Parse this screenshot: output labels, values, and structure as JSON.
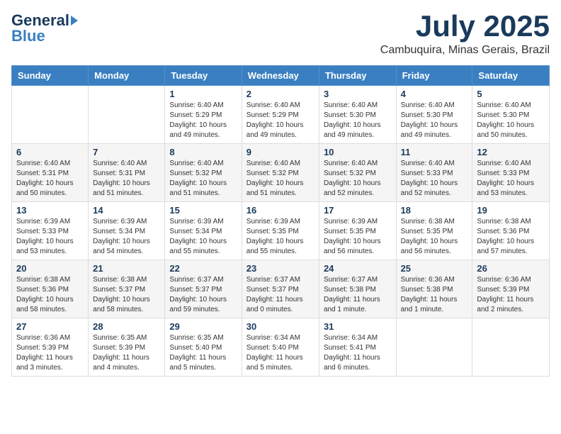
{
  "header": {
    "logo_general": "General",
    "logo_blue": "Blue",
    "month_title": "July 2025",
    "subtitle": "Cambuquira, Minas Gerais, Brazil"
  },
  "weekdays": [
    "Sunday",
    "Monday",
    "Tuesday",
    "Wednesday",
    "Thursday",
    "Friday",
    "Saturday"
  ],
  "weeks": [
    [
      {
        "day": "",
        "info": ""
      },
      {
        "day": "",
        "info": ""
      },
      {
        "day": "1",
        "info": "Sunrise: 6:40 AM\nSunset: 5:29 PM\nDaylight: 10 hours\nand 49 minutes."
      },
      {
        "day": "2",
        "info": "Sunrise: 6:40 AM\nSunset: 5:29 PM\nDaylight: 10 hours\nand 49 minutes."
      },
      {
        "day": "3",
        "info": "Sunrise: 6:40 AM\nSunset: 5:30 PM\nDaylight: 10 hours\nand 49 minutes."
      },
      {
        "day": "4",
        "info": "Sunrise: 6:40 AM\nSunset: 5:30 PM\nDaylight: 10 hours\nand 49 minutes."
      },
      {
        "day": "5",
        "info": "Sunrise: 6:40 AM\nSunset: 5:30 PM\nDaylight: 10 hours\nand 50 minutes."
      }
    ],
    [
      {
        "day": "6",
        "info": "Sunrise: 6:40 AM\nSunset: 5:31 PM\nDaylight: 10 hours\nand 50 minutes."
      },
      {
        "day": "7",
        "info": "Sunrise: 6:40 AM\nSunset: 5:31 PM\nDaylight: 10 hours\nand 51 minutes."
      },
      {
        "day": "8",
        "info": "Sunrise: 6:40 AM\nSunset: 5:32 PM\nDaylight: 10 hours\nand 51 minutes."
      },
      {
        "day": "9",
        "info": "Sunrise: 6:40 AM\nSunset: 5:32 PM\nDaylight: 10 hours\nand 51 minutes."
      },
      {
        "day": "10",
        "info": "Sunrise: 6:40 AM\nSunset: 5:32 PM\nDaylight: 10 hours\nand 52 minutes."
      },
      {
        "day": "11",
        "info": "Sunrise: 6:40 AM\nSunset: 5:33 PM\nDaylight: 10 hours\nand 52 minutes."
      },
      {
        "day": "12",
        "info": "Sunrise: 6:40 AM\nSunset: 5:33 PM\nDaylight: 10 hours\nand 53 minutes."
      }
    ],
    [
      {
        "day": "13",
        "info": "Sunrise: 6:39 AM\nSunset: 5:33 PM\nDaylight: 10 hours\nand 53 minutes."
      },
      {
        "day": "14",
        "info": "Sunrise: 6:39 AM\nSunset: 5:34 PM\nDaylight: 10 hours\nand 54 minutes."
      },
      {
        "day": "15",
        "info": "Sunrise: 6:39 AM\nSunset: 5:34 PM\nDaylight: 10 hours\nand 55 minutes."
      },
      {
        "day": "16",
        "info": "Sunrise: 6:39 AM\nSunset: 5:35 PM\nDaylight: 10 hours\nand 55 minutes."
      },
      {
        "day": "17",
        "info": "Sunrise: 6:39 AM\nSunset: 5:35 PM\nDaylight: 10 hours\nand 56 minutes."
      },
      {
        "day": "18",
        "info": "Sunrise: 6:38 AM\nSunset: 5:35 PM\nDaylight: 10 hours\nand 56 minutes."
      },
      {
        "day": "19",
        "info": "Sunrise: 6:38 AM\nSunset: 5:36 PM\nDaylight: 10 hours\nand 57 minutes."
      }
    ],
    [
      {
        "day": "20",
        "info": "Sunrise: 6:38 AM\nSunset: 5:36 PM\nDaylight: 10 hours\nand 58 minutes."
      },
      {
        "day": "21",
        "info": "Sunrise: 6:38 AM\nSunset: 5:37 PM\nDaylight: 10 hours\nand 58 minutes."
      },
      {
        "day": "22",
        "info": "Sunrise: 6:37 AM\nSunset: 5:37 PM\nDaylight: 10 hours\nand 59 minutes."
      },
      {
        "day": "23",
        "info": "Sunrise: 6:37 AM\nSunset: 5:37 PM\nDaylight: 11 hours\nand 0 minutes."
      },
      {
        "day": "24",
        "info": "Sunrise: 6:37 AM\nSunset: 5:38 PM\nDaylight: 11 hours\nand 1 minute."
      },
      {
        "day": "25",
        "info": "Sunrise: 6:36 AM\nSunset: 5:38 PM\nDaylight: 11 hours\nand 1 minute."
      },
      {
        "day": "26",
        "info": "Sunrise: 6:36 AM\nSunset: 5:39 PM\nDaylight: 11 hours\nand 2 minutes."
      }
    ],
    [
      {
        "day": "27",
        "info": "Sunrise: 6:36 AM\nSunset: 5:39 PM\nDaylight: 11 hours\nand 3 minutes."
      },
      {
        "day": "28",
        "info": "Sunrise: 6:35 AM\nSunset: 5:39 PM\nDaylight: 11 hours\nand 4 minutes."
      },
      {
        "day": "29",
        "info": "Sunrise: 6:35 AM\nSunset: 5:40 PM\nDaylight: 11 hours\nand 5 minutes."
      },
      {
        "day": "30",
        "info": "Sunrise: 6:34 AM\nSunset: 5:40 PM\nDaylight: 11 hours\nand 5 minutes."
      },
      {
        "day": "31",
        "info": "Sunrise: 6:34 AM\nSunset: 5:41 PM\nDaylight: 11 hours\nand 6 minutes."
      },
      {
        "day": "",
        "info": ""
      },
      {
        "day": "",
        "info": ""
      }
    ]
  ]
}
